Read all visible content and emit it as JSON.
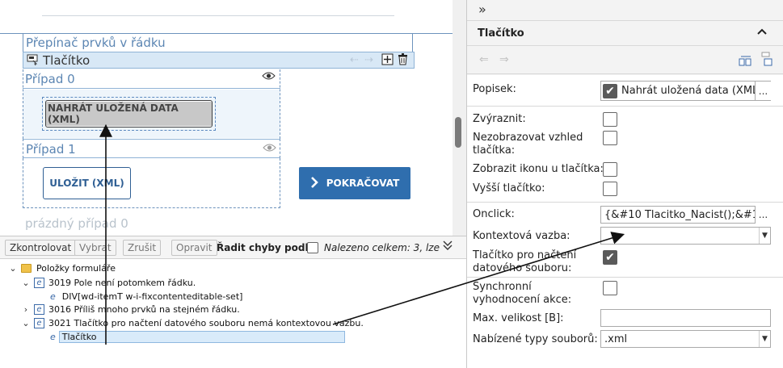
{
  "canvas": {
    "switch_label": "Přepínač prvků v řádku",
    "button_element_label": "Tlačítko",
    "case0_label": "Případ 0",
    "case1_label": "Případ 1",
    "empty_case_label": "prázdný případ 0",
    "load_button": "NAHRÁT ULOŽENÁ DATA (XML)",
    "save_button": "ULOŽIT (XML)",
    "continue_button": "POKRAČOVAT"
  },
  "errors": {
    "toolbar": {
      "check": "Zkontrolovat",
      "select": "Vybrat",
      "cancel": "Zrušit",
      "fix": "Opravit",
      "sort_label": "Řadit chyby podle",
      "found": "Nalezeno celkem: 3, lze"
    },
    "tree": {
      "root": "Položky formuláře",
      "items": [
        {
          "text": "3019 Pole není potomkem řádku.",
          "child": "DIV[wd-itemT w-i-fixcontenteditable-set]"
        },
        {
          "text": "3016 Příliš mnoho prvků na stejném řádku."
        },
        {
          "text": "3021 Tlačítko pro načtení datového souboru nemá kontextovou vazbu.",
          "child": "Tlačítko"
        }
      ]
    }
  },
  "props": {
    "collapse_glyph": "»",
    "title": "Tlačítko",
    "popisek_label": "Popisek:",
    "popisek_value": "Nahrát uložená data (XML",
    "zvyraznit": "Zvýraznit:",
    "nezobrazovat": "Nezobrazovat vzhled tlačítka:",
    "ikona": "Zobrazit ikonu u tlačítka:",
    "vyssi": "Vyšší tlačítko:",
    "onclick_label": "Onclick:",
    "onclick_value": "{&#10  Tlacitko_Nacist();&#1",
    "kontext_label": "Kontextová vazba:",
    "nacteni_label": "Tlačítko pro načtení datového souboru:",
    "sync_label": "Synchronní vyhodnocení akce:",
    "max_label": "Max. velikost [B]:",
    "typy_label": "Nabízené typy souborů:",
    "typy_value": ".xml",
    "ellipsis": "..."
  }
}
